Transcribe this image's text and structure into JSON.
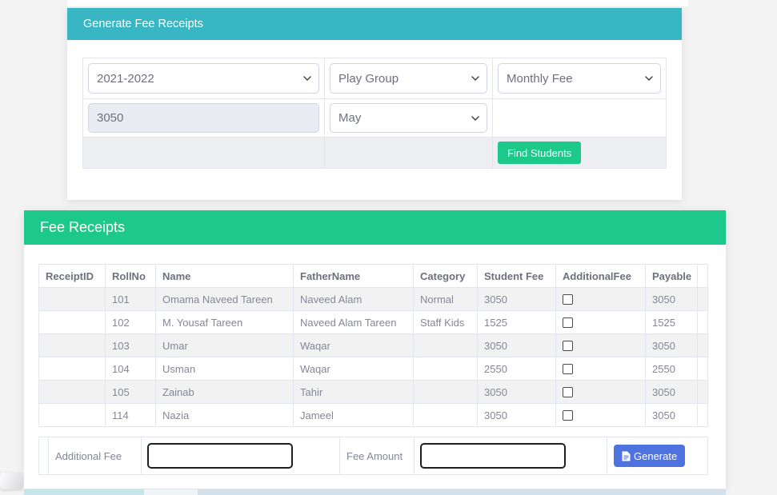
{
  "page": {
    "background": "#f3f3f4"
  },
  "colors": {
    "teal_header": "#38b6c4",
    "green": "#1cc88a",
    "blue": "#4e73df",
    "table_border": "#e3e6f0",
    "text_gray": "#858796"
  },
  "generate_panel": {
    "title": "Generate Fee Receipts",
    "fields": {
      "session": {
        "value": "2021-2022"
      },
      "class": {
        "value": "Play Group"
      },
      "fee_type": {
        "value": "Monthly Fee"
      },
      "fee_amount": {
        "value": "3050"
      },
      "month": {
        "value": "May"
      }
    },
    "find_students_button": "Find Students"
  },
  "receipts_panel": {
    "title": "Fee Receipts",
    "table": {
      "columns": [
        "ReceiptID",
        "RollNo",
        "Name",
        "FatherName",
        "Category",
        "Student Fee",
        "AdditionalFee",
        "Payable",
        ""
      ],
      "rows": [
        {
          "receipt_id": "",
          "roll_no": "101",
          "name": "Omama Naveed Tareen",
          "father_name": "Naveed Alam",
          "category": "Normal",
          "student_fee": "3050",
          "additional_fee_checked": false,
          "payable": "3050"
        },
        {
          "receipt_id": "",
          "roll_no": "102",
          "name": "M. Yousaf Tareen",
          "father_name": "Naveed Alam Tareen",
          "category": "Staff Kids",
          "student_fee": "1525",
          "additional_fee_checked": false,
          "payable": "1525"
        },
        {
          "receipt_id": "",
          "roll_no": "103",
          "name": "Umar",
          "father_name": "Waqar",
          "category": "",
          "student_fee": "3050",
          "additional_fee_checked": false,
          "payable": "3050"
        },
        {
          "receipt_id": "",
          "roll_no": "104",
          "name": "Usman",
          "father_name": "Waqar",
          "category": "",
          "student_fee": "2550",
          "additional_fee_checked": false,
          "payable": "2550"
        },
        {
          "receipt_id": "",
          "roll_no": "105",
          "name": "Zainab",
          "father_name": "Tahir",
          "category": "",
          "student_fee": "3050",
          "additional_fee_checked": false,
          "payable": "3050"
        },
        {
          "receipt_id": "",
          "roll_no": "114",
          "name": "Nazia",
          "father_name": "Jameel",
          "category": "",
          "student_fee": "3050",
          "additional_fee_checked": false,
          "payable": "3050"
        }
      ]
    },
    "footer": {
      "additional_fee_label": "Additional Fee",
      "additional_fee_value": "",
      "fee_amount_label": "Fee Amount",
      "fee_amount_value": "",
      "generate_button": "Generate"
    }
  }
}
